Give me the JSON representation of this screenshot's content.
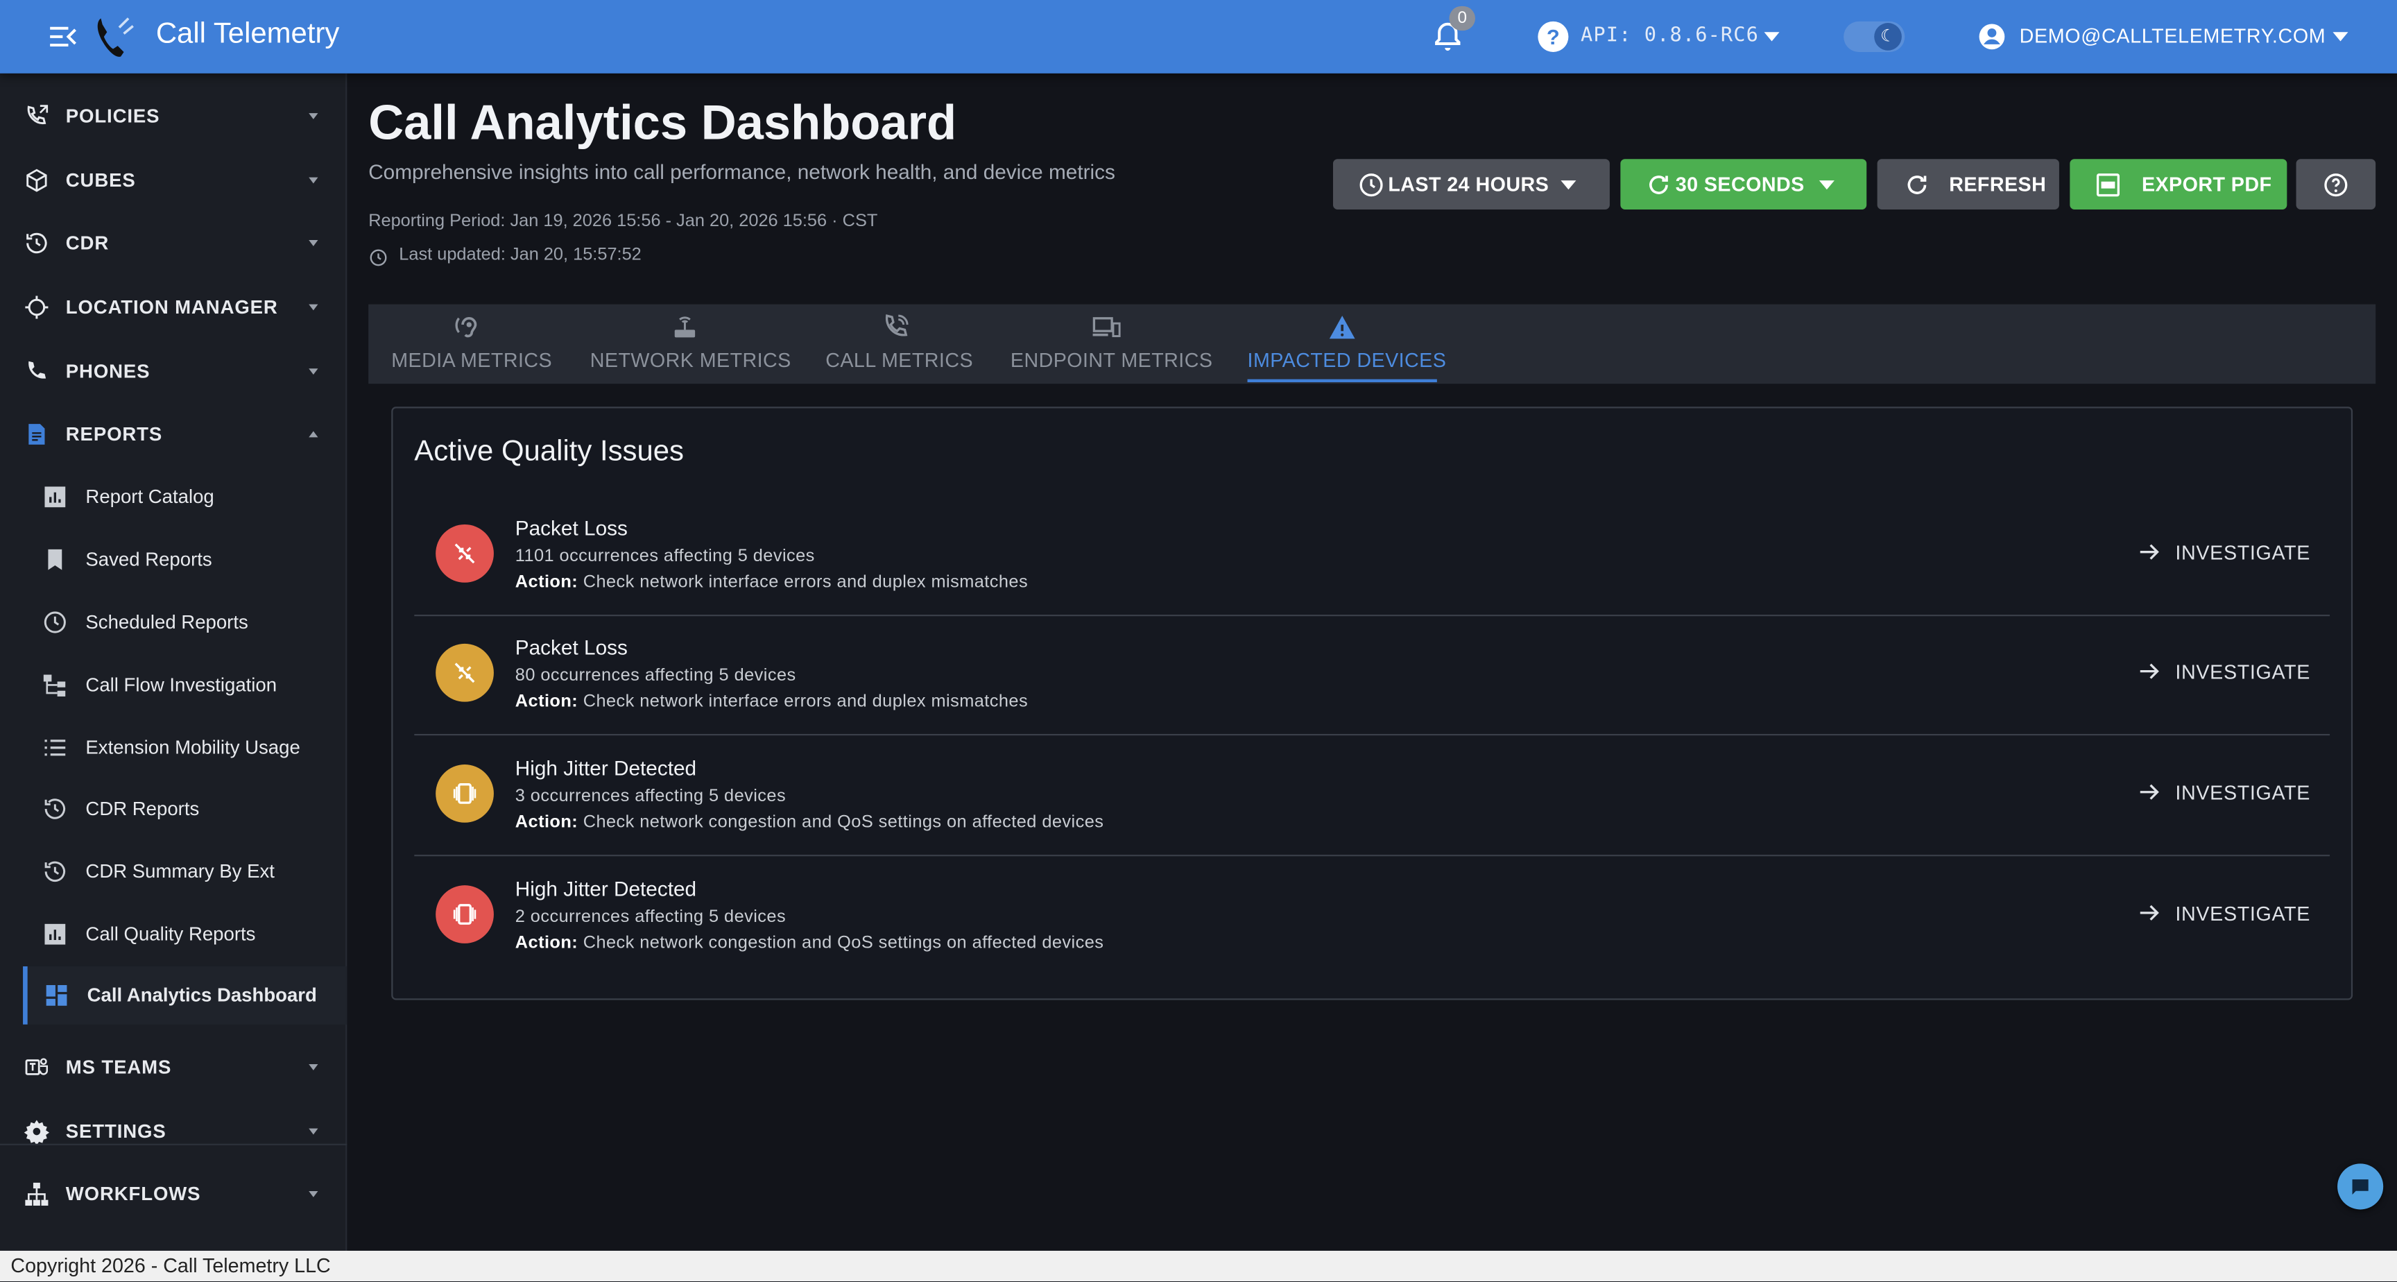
{
  "app": {
    "title": "Call Telemetry",
    "notifications_count": "0",
    "api_version": "API: 0.8.6-RC6",
    "user_email": "DEMO@CALLTELEMETRY.COM"
  },
  "sidebar": {
    "sections": [
      {
        "label": "POLICIES",
        "icon": "phone-policy-icon"
      },
      {
        "label": "CUBES",
        "icon": "cube-icon"
      },
      {
        "label": "CDR",
        "icon": "history-icon"
      },
      {
        "label": "LOCATION MANAGER",
        "icon": "crosshair-icon"
      },
      {
        "label": "PHONES",
        "icon": "phone-icon"
      },
      {
        "label": "REPORTS",
        "icon": "report-icon",
        "expanded": true
      },
      {
        "label": "MS TEAMS",
        "icon": "teams-icon"
      },
      {
        "label": "SETTINGS",
        "icon": "gear-icon"
      },
      {
        "label": "WORKFLOWS",
        "icon": "sitemap-icon"
      }
    ],
    "report_items": [
      {
        "label": "Report Catalog",
        "icon": "bar-chart-icon"
      },
      {
        "label": "Saved Reports",
        "icon": "bookmark-icon"
      },
      {
        "label": "Scheduled Reports",
        "icon": "clock-icon"
      },
      {
        "label": "Call Flow Investigation",
        "icon": "flow-icon"
      },
      {
        "label": "Extension Mobility Usage",
        "icon": "list-icon"
      },
      {
        "label": "CDR Reports",
        "icon": "history-icon"
      },
      {
        "label": "CDR Summary By Ext",
        "icon": "history-icon"
      },
      {
        "label": "Call Quality Reports",
        "icon": "bar-chart-icon"
      },
      {
        "label": "Call Analytics Dashboard",
        "icon": "dashboard-icon",
        "active": true
      }
    ]
  },
  "page": {
    "title": "Call Analytics Dashboard",
    "subtitle": "Comprehensive insights into call performance, network health, and device metrics",
    "reporting_period": "Reporting Period: Jan 19, 2026 15:56 - Jan 20, 2026 15:56 · CST",
    "last_updated": "Last updated: Jan 20, 15:57:52"
  },
  "toolbar": {
    "time_range": "LAST 24 HOURS",
    "refresh_interval": "30 SECONDS",
    "refresh": "REFRESH",
    "export_pdf": "EXPORT PDF"
  },
  "tabs": [
    {
      "label": "MEDIA METRICS",
      "icon": "hearing-icon"
    },
    {
      "label": "NETWORK METRICS",
      "icon": "router-icon"
    },
    {
      "label": "CALL METRICS",
      "icon": "phone-call-icon"
    },
    {
      "label": "ENDPOINT METRICS",
      "icon": "devices-icon"
    },
    {
      "label": "IMPACTED DEVICES",
      "icon": "warning-icon",
      "active": true
    }
  ],
  "issues_card": {
    "title": "Active Quality Issues",
    "investigate_label": "INVESTIGATE",
    "issues": [
      {
        "title": "Packet Loss",
        "occurrences": "1101 occurrences affecting 5 devices",
        "action_label": "Action:",
        "action": "Check network interface errors and duplex mismatches",
        "severity_color": "#e25450",
        "icon": "packet-loss-icon"
      },
      {
        "title": "Packet Loss",
        "occurrences": "80 occurrences affecting 5 devices",
        "action_label": "Action:",
        "action": "Check network interface errors and duplex mismatches",
        "severity_color": "#d9a33a",
        "icon": "packet-loss-icon"
      },
      {
        "title": "High Jitter Detected",
        "occurrences": "3 occurrences affecting 5 devices",
        "action_label": "Action:",
        "action": "Check network congestion and QoS settings on affected devices",
        "severity_color": "#d9a33a",
        "icon": "vibration-icon"
      },
      {
        "title": "High Jitter Detected",
        "occurrences": "2 occurrences affecting 5 devices",
        "action_label": "Action:",
        "action": "Check network congestion and QoS settings on affected devices",
        "severity_color": "#e25450",
        "icon": "vibration-icon"
      }
    ]
  },
  "footer": {
    "text": "Copyright 2026 - Call Telemetry LLC"
  },
  "colors": {
    "brand": "#3f7fd8",
    "success": "#4caf50",
    "danger": "#e25450",
    "warning": "#d9a33a"
  }
}
